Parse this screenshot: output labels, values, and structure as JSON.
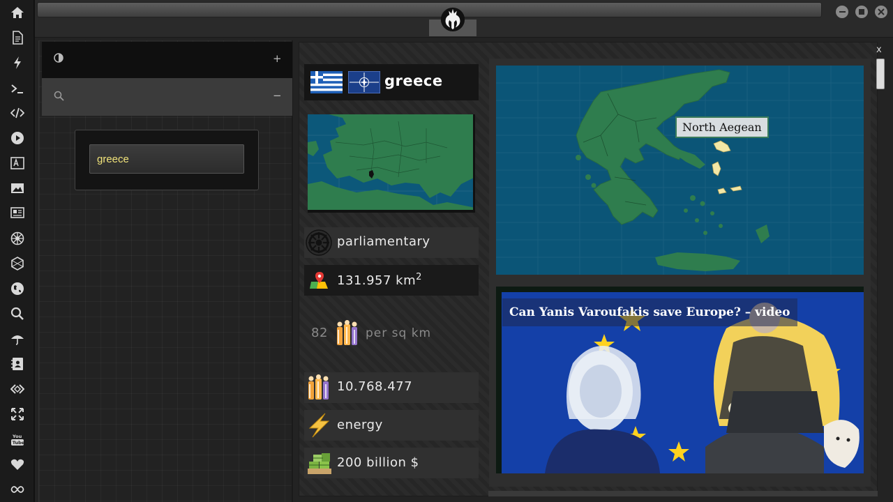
{
  "sidebar": {
    "icons": [
      "home-icon",
      "document-icon",
      "bolt-icon",
      "terminal-icon",
      "code-icon",
      "play-icon",
      "translate-icon",
      "image-icon",
      "newspaper-icon",
      "galactic-empire-icon",
      "hexagon-icon",
      "globe-icon",
      "search-icon",
      "umbrella-icon",
      "contacts-icon",
      "code-diamond-icon",
      "expand-icon",
      "youtube-icon",
      "heart-icon",
      "infinity-icon"
    ]
  },
  "topbar": {
    "logo": "rebel-alliance-icon",
    "window_buttons": [
      "minimize-icon",
      "maximize-icon",
      "close-icon"
    ]
  },
  "left_panel": {
    "row1_left_icon": "contrast-icon",
    "row1_right": "+",
    "row2_left_icon": "search-icon",
    "row2_right": "−",
    "search": {
      "value": "greece"
    }
  },
  "country": {
    "name": "greece",
    "flag": "greece-flag",
    "alliance": "nato-flag",
    "government": "parliamentary",
    "area_value": "131.957 km",
    "area_sup": "2",
    "density_value": "82",
    "density_unit": "per sq km",
    "population": "10.768.477",
    "resource": "energy",
    "gdp": "200 billion $"
  },
  "map": {
    "region_label": "North Aegean",
    "close_label": "x"
  },
  "video": {
    "title": "Can Yanis Varoufakis save Europe? – video"
  },
  "colors": {
    "land": "#2f7d4e",
    "sea": "#0b5577",
    "accent_text": "#f1e37a"
  }
}
